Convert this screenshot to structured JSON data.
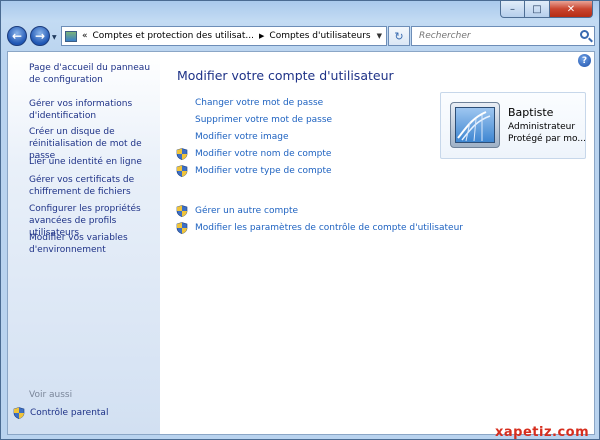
{
  "window": {
    "buttons": {
      "minimize": "–",
      "maximize": "□",
      "close": "✕"
    }
  },
  "nav": {
    "back_icon": "arrow-left-icon",
    "forward_icon": "arrow-right-icon",
    "address": {
      "prefix": "«",
      "segments": [
        "Comptes et protection des utilisat...",
        "Comptes d'utilisateurs"
      ],
      "separator": "▶"
    },
    "refresh_icon": "↻",
    "search_placeholder": "Rechercher"
  },
  "sidebar": {
    "items": [
      {
        "label": "Page d'accueil du panneau de configuration"
      },
      {
        "label": "Gérer vos informations d'identification"
      },
      {
        "label": "Créer un disque de réinitialisation de mot de passe"
      },
      {
        "label": "Lier une identité en ligne"
      },
      {
        "label": "Gérer vos certificats de chiffrement de fichiers"
      },
      {
        "label": "Configurer les propriétés avancées de profils utilisateurs"
      },
      {
        "label": "Modifier vos variables d'environnement"
      }
    ],
    "see_also": "Voir aussi",
    "parental_control": "Contrôle parental"
  },
  "main": {
    "title": "Modifier votre compte d'utilisateur",
    "help": "?",
    "tasks": [
      {
        "label": "Changer votre mot de passe",
        "shield": false
      },
      {
        "label": "Supprimer votre mot de passe",
        "shield": false
      },
      {
        "label": "Modifier votre image",
        "shield": false
      },
      {
        "label": "Modifier votre nom de compte",
        "shield": true
      },
      {
        "label": "Modifier votre type de compte",
        "shield": true
      }
    ],
    "tasks2": [
      {
        "label": "Gérer un autre compte",
        "shield": true
      },
      {
        "label": "Modifier les paramètres de contrôle de compte d'utilisateur",
        "shield": true
      }
    ]
  },
  "user": {
    "name": "Baptiste",
    "role": "Administrateur",
    "protection": "Protégé par mo..."
  },
  "watermark": "xapetiz.com"
}
